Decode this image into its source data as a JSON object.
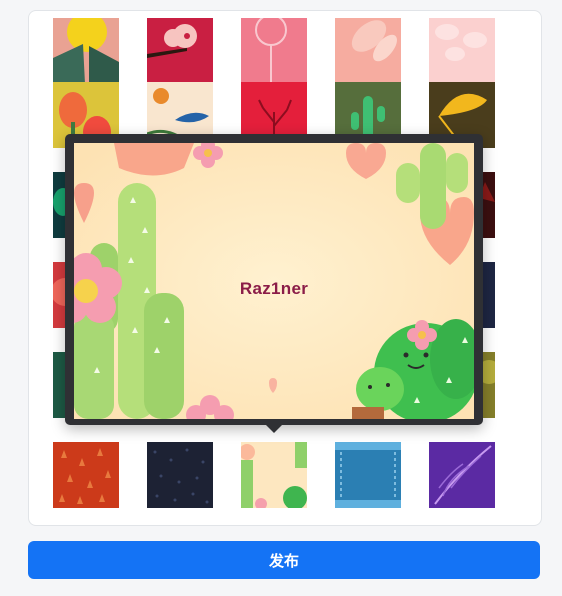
{
  "gallery": {
    "rows": [
      {
        "row": 1,
        "tiles": [
          {
            "name": "tile-yellow-flower",
            "color": "#e9a293"
          },
          {
            "name": "tile-pink-blossom",
            "color": "#c91f42"
          },
          {
            "name": "tile-dandelion-pink",
            "color": "#f07b8d"
          },
          {
            "name": "tile-peach-leaves",
            "color": "#f6aca0"
          },
          {
            "name": "tile-pale-pink-pattern",
            "color": "#fbd0cf"
          }
        ]
      },
      {
        "row": 2,
        "tiles": [
          {
            "name": "tile-tulips-yellow",
            "color": "#dcc43a"
          },
          {
            "name": "tile-bird-floral",
            "color": "#f9e6cf"
          },
          {
            "name": "tile-red-branch",
            "color": "#e41f3b"
          },
          {
            "name": "tile-green-cactus",
            "color": "#566e3c"
          },
          {
            "name": "tile-ginkgo-dark",
            "color": "#4a3d1c"
          }
        ]
      },
      {
        "row": 3,
        "tiles": [
          {
            "name": "tile-dark-teal",
            "color": "#0f3c3f"
          },
          {
            "name": "tile-maroon",
            "color": "#3c0f10"
          }
        ]
      },
      {
        "row": 4,
        "tiles": [
          {
            "name": "tile-red-flower",
            "color": "#d43a3e"
          },
          {
            "name": "tile-navy",
            "color": "#1e2643"
          }
        ]
      },
      {
        "row": 5,
        "tiles": [
          {
            "name": "tile-dark-green",
            "color": "#1d5a45"
          },
          {
            "name": "tile-olive",
            "color": "#857f2a"
          }
        ]
      },
      {
        "row": 6,
        "tiles": [
          {
            "name": "tile-orange-pattern",
            "color": "#cc3a1a"
          },
          {
            "name": "tile-dark-speckle",
            "color": "#1d2234"
          },
          {
            "name": "tile-cactus-frame",
            "color": "#fde7c0"
          },
          {
            "name": "tile-blue-denim",
            "color": "#2b7fb3"
          },
          {
            "name": "tile-purple-feather",
            "color": "#5b2aa3"
          }
        ]
      }
    ]
  },
  "preview": {
    "title": "Raz1ner"
  },
  "actions": {
    "publish_label": "发布",
    "publish_color": "#1473f5"
  }
}
